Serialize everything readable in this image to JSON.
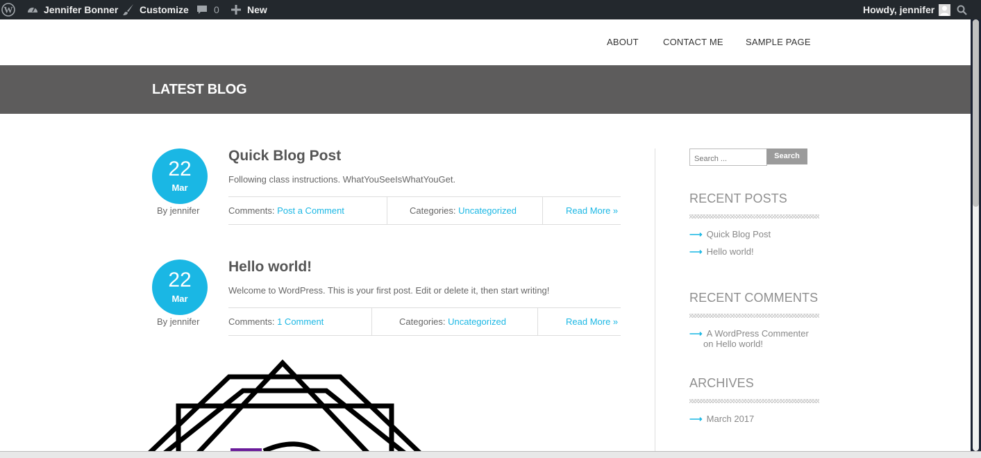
{
  "admin_bar": {
    "site_name": "Jennifer Bonner",
    "customize": "Customize",
    "comments_count": "0",
    "new": "New",
    "greeting": "Howdy, jennifer"
  },
  "nav": [
    "ABOUT",
    "CONTACT ME",
    "SAMPLE PAGE"
  ],
  "banner_title": "LATEST BLOG",
  "posts": [
    {
      "day": "22",
      "month": "Mar",
      "byline": "By jennifer",
      "title": "Quick Blog Post",
      "excerpt": "Following class instructions. WhatYouSeeIsWhatYouGet.",
      "comments_label": "Comments:",
      "comments_link": "Post a Comment",
      "categories_label": "Categories:",
      "category": "Uncategorized",
      "read_more": "Read More »"
    },
    {
      "day": "22",
      "month": "Mar",
      "byline": "By jennifer",
      "title": "Hello world!",
      "excerpt": "Welcome to WordPress. This is your first post. Edit or delete it, then start writing!",
      "comments_label": "Comments:",
      "comments_link": "1 Comment",
      "categories_label": "Categories:",
      "category": "Uncategorized",
      "read_more": "Read More »"
    }
  ],
  "sidebar": {
    "search_placeholder": "Search ...",
    "search_button": "Search",
    "recent_posts_title": "RECENT POSTS",
    "recent_posts": [
      "Quick Blog Post",
      "Hello world!"
    ],
    "recent_comments_title": "RECENT COMMENTS",
    "recent_comment_line1": "A WordPress Commenter",
    "recent_comment_line2": "on Hello world!",
    "archives_title": "ARCHIVES",
    "archives": [
      "March 2017"
    ]
  },
  "colors": {
    "accent": "#1ab7e4",
    "admin_bar": "#23282d",
    "banner": "#5d5c5c",
    "logo_purple": "#6a1b9a"
  },
  "icons": [
    "wordpress-icon",
    "dashboard-icon",
    "brush-icon",
    "comment-icon",
    "plus-icon",
    "avatar-icon",
    "search-icon",
    "arrow-right-icon"
  ]
}
